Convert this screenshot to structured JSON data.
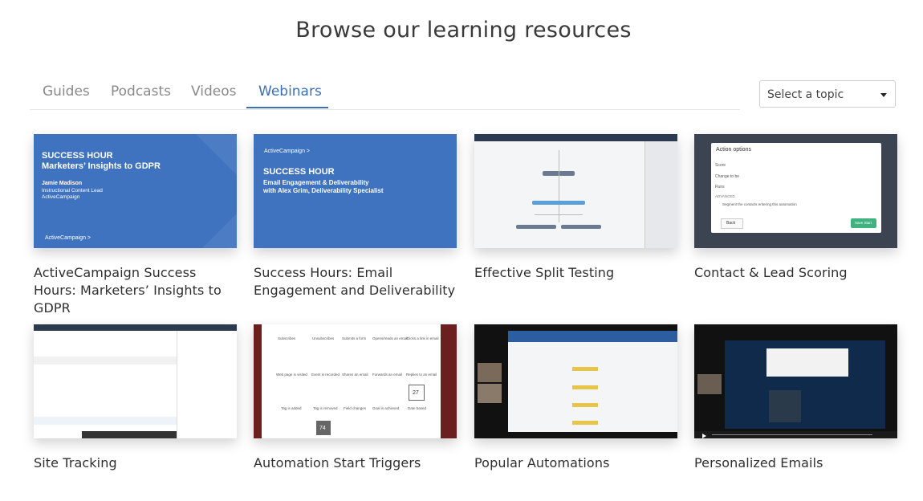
{
  "page": {
    "title": "Browse our learning resources"
  },
  "tabs": [
    {
      "label": "Guides",
      "active": false
    },
    {
      "label": "Podcasts",
      "active": false
    },
    {
      "label": "Videos",
      "active": false
    },
    {
      "label": "Webinars",
      "active": true
    }
  ],
  "topic_select": {
    "value": "Select a topic"
  },
  "colors": {
    "accent": "#3b6fb6",
    "slide_blue": "#3f73c0"
  },
  "cards": [
    {
      "title": "ActiveCampaign Success Hours: Marketers’ Insights to GDPR",
      "thumb": {
        "heading1": "SUCCESS HOUR",
        "heading2": "Marketers’ Insights to GDPR",
        "line1": "Jamie Madison",
        "line2": "Instructional Content Lead",
        "line3": "ActiveCampaign",
        "brand": "ActiveCampaign >"
      }
    },
    {
      "title": "Success Hours: Email Engagement and Deliverability",
      "thumb": {
        "brand": "ActiveCampaign >",
        "heading1": "SUCCESS HOUR",
        "line1": "Email Engagement & Deliverability",
        "line2": "with Alex Grim, Deliverability Specialist"
      }
    },
    {
      "title": "Effective Split Testing"
    },
    {
      "title": "Contact & Lead Scoring",
      "thumb": {
        "dialog_title": "Action options",
        "row1": "Score",
        "row2": "Change to be",
        "row3": "Runs",
        "advanced": "ADVANCED",
        "checkbox": "Segment the contacts entering this automation",
        "back": "Back",
        "save": "Save Start"
      }
    },
    {
      "title": "Site Tracking"
    },
    {
      "title": "Automation Start Triggers",
      "thumb": {
        "row1": [
          "Subscribes",
          "Unsubscribes",
          "Submits a form",
          "Opens/reads an email",
          "Clicks a link in email"
        ],
        "row2": [
          "Web page is visited",
          "Event is recorded",
          "Shares an email",
          "Forwards an email",
          "Replies to an email"
        ],
        "row3": [
          "Tag is added",
          "Tag is removed",
          "Field changes",
          "Goal is achieved",
          "Date based"
        ],
        "badge": "74",
        "date": "27"
      }
    },
    {
      "title": "Popular Automations"
    },
    {
      "title": "Personalized Emails"
    }
  ]
}
